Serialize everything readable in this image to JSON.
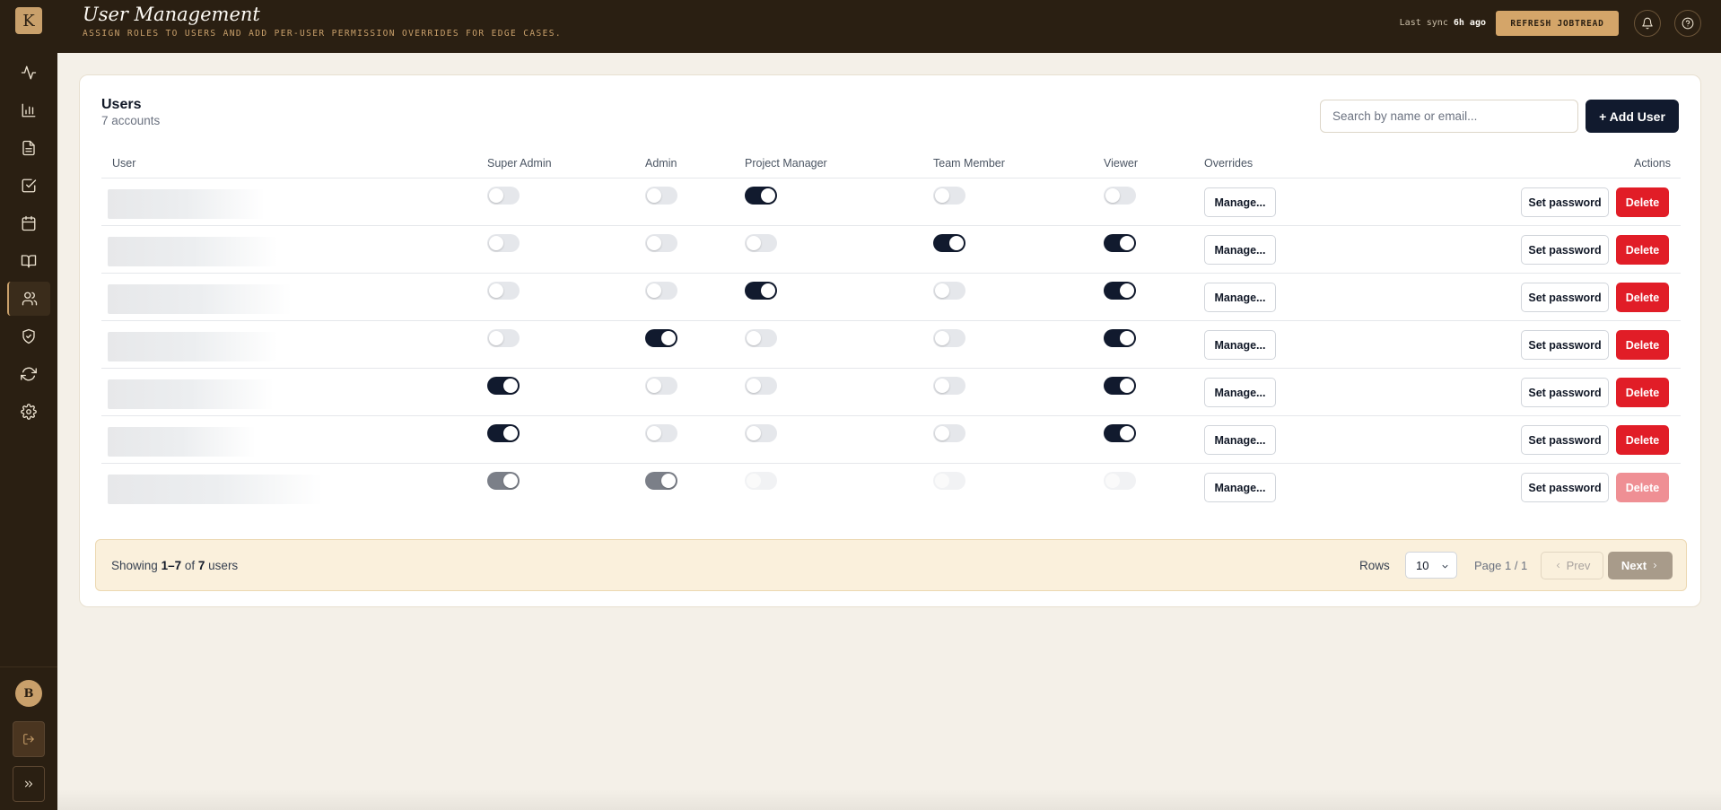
{
  "app": {
    "logo_letter": "K",
    "user_initial": "B"
  },
  "header": {
    "title": "User Management",
    "subtitle": "ASSIGN ROLES TO USERS AND ADD PER-USER PERMISSION OVERRIDES FOR EDGE CASES.",
    "sync_label": "Last sync",
    "sync_value": "6h ago",
    "refresh_label": "REFRESH JOBTREAD"
  },
  "sidebar": {
    "items": [
      {
        "icon": "activity-icon",
        "active": false
      },
      {
        "icon": "bar-chart-icon",
        "active": false
      },
      {
        "icon": "document-icon",
        "active": false
      },
      {
        "icon": "checkbox-icon",
        "active": false
      },
      {
        "icon": "calendar-icon",
        "active": false
      },
      {
        "icon": "book-icon",
        "active": false
      },
      {
        "icon": "users-icon",
        "active": true
      },
      {
        "icon": "shield-check-icon",
        "active": false
      },
      {
        "icon": "refresh-icon",
        "active": false
      },
      {
        "icon": "gear-icon",
        "active": false
      }
    ]
  },
  "users_card": {
    "title": "Users",
    "count": "7 accounts",
    "search_placeholder": "Search by name or email...",
    "add_label": "+ Add User"
  },
  "table": {
    "columns": [
      "User",
      "Super Admin",
      "Admin",
      "Project Manager",
      "Team Member",
      "Viewer",
      "Overrides",
      "Actions"
    ],
    "manage_label": "Manage...",
    "set_password_label": "Set password",
    "delete_label": "Delete",
    "rows": [
      {
        "super_admin": false,
        "admin": false,
        "project_manager": true,
        "team_member": false,
        "viewer": false,
        "locked": false
      },
      {
        "super_admin": false,
        "admin": false,
        "project_manager": false,
        "team_member": true,
        "viewer": true,
        "locked": false
      },
      {
        "super_admin": false,
        "admin": false,
        "project_manager": true,
        "team_member": false,
        "viewer": true,
        "locked": false
      },
      {
        "super_admin": false,
        "admin": true,
        "project_manager": false,
        "team_member": false,
        "viewer": true,
        "locked": false
      },
      {
        "super_admin": true,
        "admin": false,
        "project_manager": false,
        "team_member": false,
        "viewer": true,
        "locked": false
      },
      {
        "super_admin": true,
        "admin": false,
        "project_manager": false,
        "team_member": false,
        "viewer": true,
        "locked": false
      },
      {
        "super_admin": true,
        "admin": true,
        "project_manager": false,
        "team_member": false,
        "viewer": false,
        "locked": true
      }
    ]
  },
  "pagination": {
    "showing_prefix": "Showing",
    "range": "1–7",
    "of": "of",
    "total": "7",
    "suffix": "users",
    "rows_label": "Rows",
    "rows_value": "10",
    "page_info": "Page 1 / 1",
    "prev_label": "Prev",
    "next_label": "Next"
  }
}
